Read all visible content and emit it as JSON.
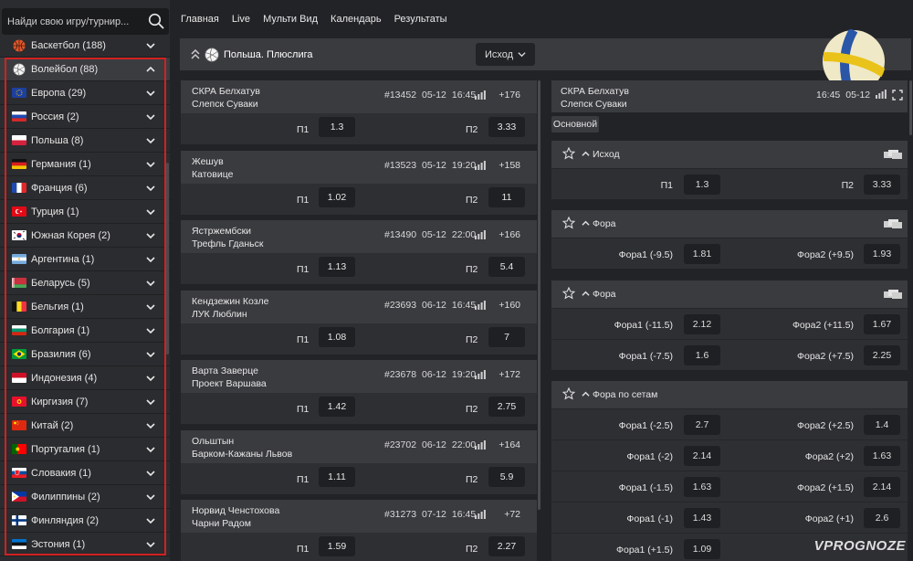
{
  "search": {
    "placeholder": "Найди свою игру/турнир..."
  },
  "nav": [
    "Главная",
    "Live",
    "Мульти Вид",
    "Календарь",
    "Результаты"
  ],
  "sidebar": {
    "sports": [
      {
        "label": "Баскетбол (188)",
        "icon": "basketball-icon",
        "color": "#e2572b"
      },
      {
        "label": "Волейбол (88)",
        "icon": "volleyball-icon",
        "color": "#ffffff"
      }
    ],
    "countries": [
      {
        "label": "Европа (29)",
        "flag": "eu"
      },
      {
        "label": "Россия (2)",
        "flag": "ru"
      },
      {
        "label": "Польша (8)",
        "flag": "pl"
      },
      {
        "label": "Германия (1)",
        "flag": "de"
      },
      {
        "label": "Франция (6)",
        "flag": "fr"
      },
      {
        "label": "Турция (1)",
        "flag": "tr"
      },
      {
        "label": "Южная Корея (2)",
        "flag": "kr"
      },
      {
        "label": "Аргентина (1)",
        "flag": "ar"
      },
      {
        "label": "Беларусь (5)",
        "flag": "by"
      },
      {
        "label": "Бельгия (1)",
        "flag": "be"
      },
      {
        "label": "Болгария (1)",
        "flag": "bg"
      },
      {
        "label": "Бразилия (6)",
        "flag": "br"
      },
      {
        "label": "Индонезия (4)",
        "flag": "id"
      },
      {
        "label": "Киргизия (7)",
        "flag": "kg"
      },
      {
        "label": "Китай (2)",
        "flag": "cn"
      },
      {
        "label": "Португалия (1)",
        "flag": "pt"
      },
      {
        "label": "Словакия (1)",
        "flag": "sk"
      },
      {
        "label": "Филиппины (2)",
        "flag": "ph"
      },
      {
        "label": "Финляндия (2)",
        "flag": "fi"
      },
      {
        "label": "Эстония (1)",
        "flag": "ee"
      }
    ]
  },
  "league": {
    "title": "Польша. Плюслига",
    "select": "Исход"
  },
  "matches": [
    {
      "home": "СКРА Белхатув",
      "away": "Слепск Суваки",
      "id": "#13452",
      "date": "05-12",
      "time": "16:45",
      "more": "+176",
      "p1_label": "П1",
      "p1": "1.3",
      "p2_label": "П2",
      "p2": "3.33"
    },
    {
      "home": "Жешув",
      "away": "Катовице",
      "id": "#13523",
      "date": "05-12",
      "time": "19:20",
      "more": "+158",
      "p1_label": "П1",
      "p1": "1.02",
      "p2_label": "П2",
      "p2": "11"
    },
    {
      "home": "Ястржембски",
      "away": "Трефль Гданьск",
      "id": "#13490",
      "date": "05-12",
      "time": "22:00",
      "more": "+166",
      "p1_label": "П1",
      "p1": "1.13",
      "p2_label": "П2",
      "p2": "5.4"
    },
    {
      "home": "Кендзежин Козле",
      "away": "ЛУК Люблин",
      "id": "#23693",
      "date": "06-12",
      "time": "16:45",
      "more": "+160",
      "p1_label": "П1",
      "p1": "1.08",
      "p2_label": "П2",
      "p2": "7"
    },
    {
      "home": "Варта Заверце",
      "away": "Проект Варшава",
      "id": "#23678",
      "date": "06-12",
      "time": "19:20",
      "more": "+172",
      "p1_label": "П1",
      "p1": "1.42",
      "p2_label": "П2",
      "p2": "2.75"
    },
    {
      "home": "Ольштын",
      "away": "Барком-Кажаны Львов",
      "id": "#23702",
      "date": "06-12",
      "time": "22:00",
      "more": "+164",
      "p1_label": "П1",
      "p1": "1.11",
      "p2_label": "П2",
      "p2": "5.9"
    },
    {
      "home": "Норвид Ченстохова",
      "away": "Чарни Радом",
      "id": "#31273",
      "date": "07-12",
      "time": "16:45",
      "more": "+72",
      "p1_label": "П1",
      "p1": "1.59",
      "p2_label": "П2",
      "p2": "2.27"
    }
  ],
  "detail": {
    "home": "СКРА Белхатув",
    "away": "Слепск Суваки",
    "time": "16:45",
    "date": "05-12",
    "tab": "Основной",
    "markets": [
      {
        "title": "Исход",
        "rows": [
          {
            "l1": "П1",
            "o1": "1.3",
            "l2": "П2",
            "o2": "3.33"
          }
        ]
      },
      {
        "title": "Фора",
        "rows": [
          {
            "l1": "Фора1 (-9.5)",
            "o1": "1.81",
            "l2": "Фора2 (+9.5)",
            "o2": "1.93"
          }
        ]
      },
      {
        "title": "Фора",
        "rows": [
          {
            "l1": "Фора1 (-11.5)",
            "o1": "2.12",
            "l2": "Фора2 (+11.5)",
            "o2": "1.67"
          },
          {
            "l1": "Фора1 (-7.5)",
            "o1": "1.6",
            "l2": "Фора2 (+7.5)",
            "o2": "2.25"
          }
        ]
      },
      {
        "title": "Фора по сетам",
        "rows": [
          {
            "l1": "Фора1 (-2.5)",
            "o1": "2.7",
            "l2": "Фора2 (+2.5)",
            "o2": "1.4"
          },
          {
            "l1": "Фора1 (-2)",
            "o1": "2.14",
            "l2": "Фора2 (+2)",
            "o2": "1.63"
          },
          {
            "l1": "Фора1 (-1.5)",
            "o1": "1.63",
            "l2": "Фора2 (+1.5)",
            "o2": "2.14"
          },
          {
            "l1": "Фора1 (-1)",
            "o1": "1.43",
            "l2": "Фора2 (+1)",
            "o2": "2.6"
          },
          {
            "l1": "Фора1 (+1.5)",
            "o1": "1.09",
            "l2": "",
            "o2": ""
          }
        ]
      }
    ]
  },
  "watermark": "VPROGNOZE"
}
